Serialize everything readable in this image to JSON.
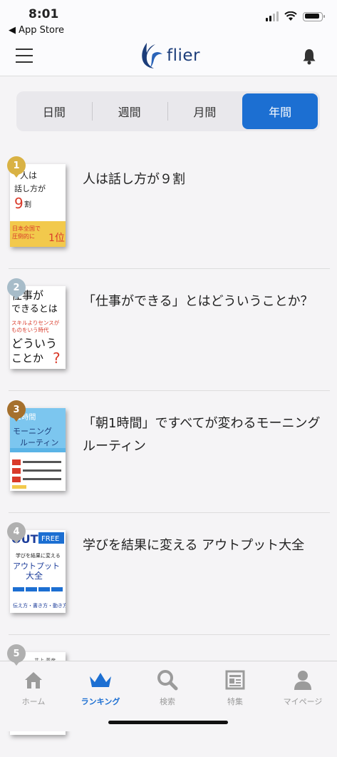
{
  "status": {
    "time": "8:01",
    "back_app": "◀ App Store"
  },
  "header": {
    "logo_text": "flier"
  },
  "segments": [
    "日間",
    "週間",
    "月間",
    "年間"
  ],
  "active_segment": "年間",
  "rankings": [
    {
      "rank": "1",
      "title": "人は話し方が９割",
      "cover": {
        "bg": "#ffffff",
        "accent": "#d93a2a",
        "band": "#f2c94c",
        "lines": [
          "人は",
          "話し方が",
          "9割"
        ]
      }
    },
    {
      "rank": "2",
      "title": "「仕事ができる」とはどういうことか？",
      "cover": {
        "bg": "#ffffff",
        "accent": "#d93a2a",
        "band": "#ffffff",
        "lines": [
          "仕事が",
          "できるとは",
          "どういう",
          "ことか?"
        ]
      }
    },
    {
      "rank": "3",
      "title": "「朝1時間」ですべてが変わるモーニングルーティン",
      "cover": {
        "bg": "#5ab4e6",
        "accent": "#2a4c9a",
        "band": "#ffffff",
        "lines": [
          "1時間",
          "モーニング",
          "ルーティン"
        ]
      }
    },
    {
      "rank": "4",
      "title": "学びを結果に変える アウトプット大全",
      "cover": {
        "bg": "#ffffff",
        "accent": "#1c3d9a",
        "band": "#1c6fd2",
        "lines": [
          "OUT FREE",
          "アウトプット",
          "大全"
        ]
      }
    },
    {
      "rank": "5",
      "title": "",
      "cover": {
        "bg": "#ffffff",
        "accent": "#555555",
        "band": "#ffffff",
        "lines": [
          "井上 義彦"
        ]
      }
    }
  ],
  "tabs": [
    {
      "label": "ホーム",
      "icon": "home-icon"
    },
    {
      "label": "ランキング",
      "icon": "crown-icon"
    },
    {
      "label": "検索",
      "icon": "search-icon"
    },
    {
      "label": "特集",
      "icon": "newspaper-icon"
    },
    {
      "label": "マイページ",
      "icon": "person-icon"
    }
  ],
  "colors": {
    "accent": "#1c6fd2",
    "logo": "#1c3d7a",
    "inactive": "#9b9b9b"
  }
}
